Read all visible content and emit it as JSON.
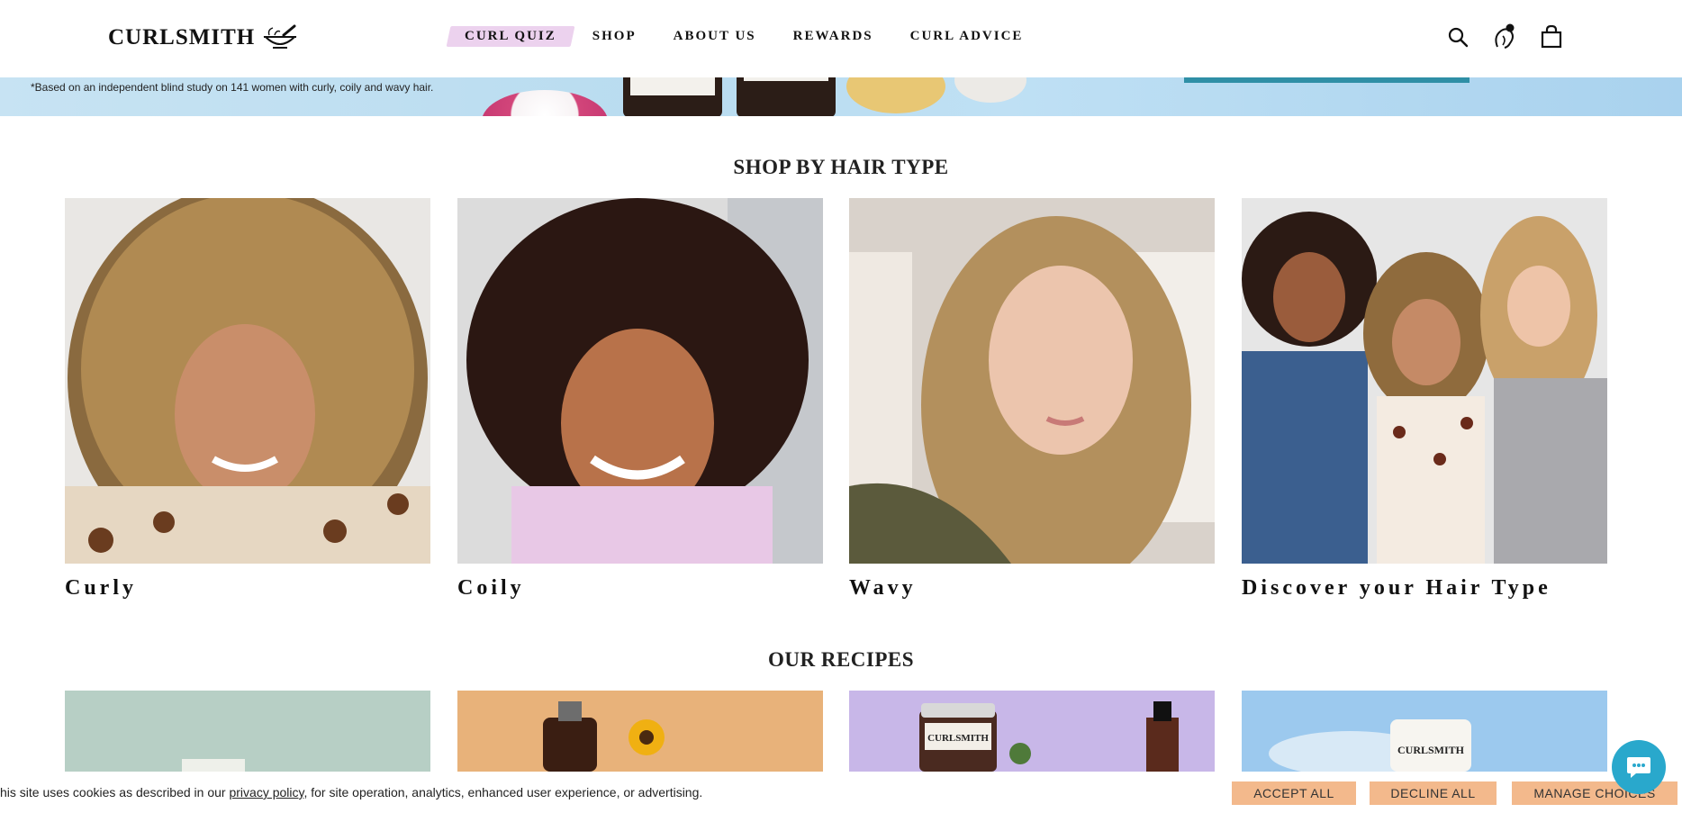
{
  "header": {
    "logo_text": "CURLSMITH",
    "nav": [
      {
        "label": "CURL QUIZ",
        "highlight": true
      },
      {
        "label": "SHOP"
      },
      {
        "label": "ABOUT US"
      },
      {
        "label": "REWARDS"
      },
      {
        "label": "CURL ADVICE"
      }
    ],
    "icons": [
      "search-icon",
      "account-icon",
      "bag-icon"
    ],
    "highlight_color": "#ecd2ee"
  },
  "hero": {
    "note": "*Based on an independent blind study on 141 women with curly, coily and wavy hair."
  },
  "hair_types": {
    "title": "SHOP BY HAIR TYPE",
    "cards": [
      {
        "label": "Curly"
      },
      {
        "label": "Coily"
      },
      {
        "label": "Wavy"
      },
      {
        "label": "Discover your Hair Type"
      }
    ]
  },
  "recipes": {
    "title": "OUR RECIPES",
    "product_label": "CURLSMITH"
  },
  "cookie": {
    "text_before": "his site uses cookies as described in our ",
    "link": "privacy policy",
    "text_after": ", for site operation, analytics, enhanced user experience, or advertising.",
    "accept": "ACCEPT ALL",
    "decline": "DECLINE ALL",
    "manage": "MANAGE CHOICES",
    "button_color": "#f3b98c"
  },
  "colors": {
    "accent_teal": "#2f8fa6",
    "chat": "#29a8cc"
  }
}
